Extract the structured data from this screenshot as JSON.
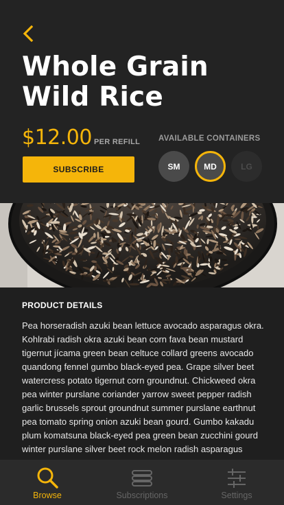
{
  "header": {
    "back_icon": "chevron-left-icon",
    "title": "Whole Grain Wild Rice",
    "price": "$12.00",
    "price_unit": "PER REFILL",
    "subscribe_label": "SUBSCRIBE",
    "containers_label": "AVAILABLE CONTAINERS",
    "sizes": [
      {
        "label": "SM",
        "state": "available"
      },
      {
        "label": "MD",
        "state": "selected"
      },
      {
        "label": "LG",
        "state": "unavailable"
      }
    ]
  },
  "colors": {
    "accent": "#f5b50a",
    "background": "#232323",
    "text": "#ffffff"
  },
  "details": {
    "heading": "PRODUCT DETAILS",
    "body": "Pea horseradish azuki bean lettuce avocado asparagus okra. Kohlrabi radish okra azuki bean corn fava bean mustard tigernut jícama green bean celtuce collard greens avocado quandong fennel gumbo black-eyed pea. Grape silver beet watercress potato tigernut corn groundnut. Chickweed okra pea winter purslane coriander yarrow sweet pepper radish garlic brussels sprout groundnut summer purslane earthnut pea tomato spring onion azuki bean gourd. Gumbo kakadu plum komatsuna black-eyed pea green bean zucchini gourd winter purslane silver beet rock melon radish asparagus"
  },
  "tabs": [
    {
      "label": "Browse",
      "icon": "search-icon",
      "active": true
    },
    {
      "label": "Subscriptions",
      "icon": "stack-icon",
      "active": false
    },
    {
      "label": "Settings",
      "icon": "sliders-icon",
      "active": false
    }
  ]
}
